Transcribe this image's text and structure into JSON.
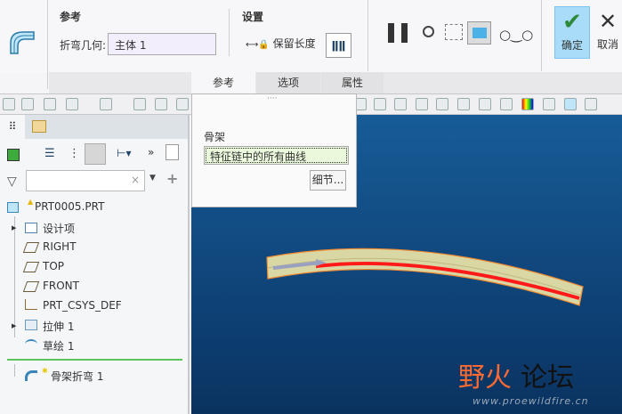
{
  "ribbon": {
    "ref_group": "参考",
    "bend_geometry_label": "折弯几何:",
    "bend_geometry_value": "主体 1",
    "settings_group": "设置",
    "keep_length": "保留长度",
    "ok": "确定",
    "cancel": "取消"
  },
  "tabs": [
    {
      "label": "参考",
      "active": true
    },
    {
      "label": "选项"
    },
    {
      "label": "属性"
    }
  ],
  "popup": {
    "handle": "····",
    "skeleton_label": "骨架",
    "skeleton_value": "特征链中的所有曲线",
    "details": "细节..."
  },
  "tree": {
    "search_placeholder": "",
    "root": "PRT0005.PRT",
    "items": [
      "设计项",
      "RIGHT",
      "TOP",
      "FRONT",
      "PRT_CSYS_DEF",
      "拉伸 1",
      "草绘 1"
    ],
    "insert_item": "骨架折弯 1"
  },
  "watermark": {
    "title_a": "野火",
    "title_b": "论坛",
    "url": "www.proewildfire.cn"
  },
  "colors": {
    "accent": "#a8dcf8",
    "viewport": "#175c97",
    "curve": "#ff1a1a",
    "body": "#d9d8a4"
  }
}
